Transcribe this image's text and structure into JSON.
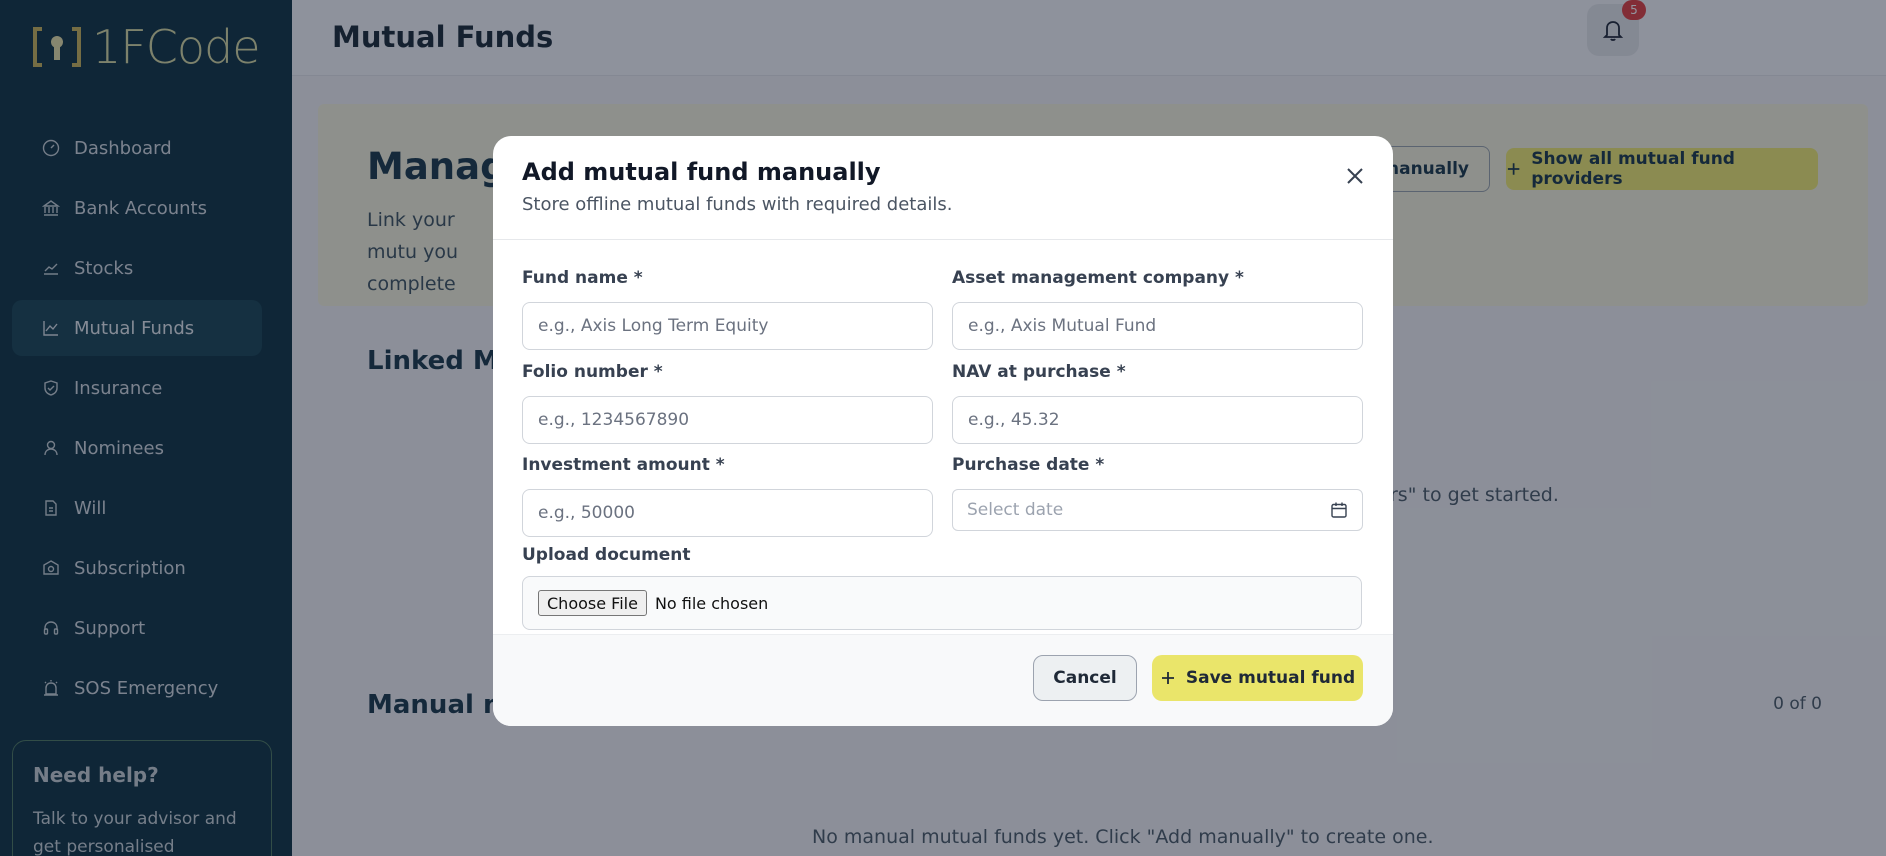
{
  "brand": {
    "name": "1FCode",
    "accent": "#d8dba2"
  },
  "sidebar": {
    "items": [
      {
        "label": "Dashboard",
        "icon": "gauge-icon"
      },
      {
        "label": "Bank Accounts",
        "icon": "bank-icon"
      },
      {
        "label": "Stocks",
        "icon": "trend-icon"
      },
      {
        "label": "Mutual Funds",
        "icon": "chart-line-icon",
        "active": true
      },
      {
        "label": "Insurance",
        "icon": "shield-icon"
      },
      {
        "label": "Nominees",
        "icon": "user-icon"
      },
      {
        "label": "Will",
        "icon": "document-icon"
      },
      {
        "label": "Subscription",
        "icon": "badge-icon"
      },
      {
        "label": "Support",
        "icon": "headset-icon"
      },
      {
        "label": "SOS Emergency",
        "icon": "alarm-icon"
      }
    ],
    "help": {
      "title": "Need help?",
      "text": "Talk to your advisor and get personalised"
    }
  },
  "header": {
    "title": "Mutual Funds",
    "notification_count": "5"
  },
  "main": {
    "hero_title": "Manage",
    "hero_desc": "Link your mutu you complete",
    "add_manually_label": "manually",
    "show_providers_label": "Show all mutual fund providers",
    "linked_title": "Linked Mut",
    "linked_empty": "rs\" to get started.",
    "manual_title": "Manual mu",
    "manual_count": "0 of 0",
    "manual_empty": "No manual mutual funds yet. Click \"Add manually\" to create one."
  },
  "modal": {
    "title": "Add mutual fund manually",
    "subtitle": "Store offline mutual funds with required details.",
    "fields": {
      "fund_name": {
        "label": "Fund name *",
        "placeholder": "e.g., Axis Long Term Equity"
      },
      "amc": {
        "label": "Asset management company *",
        "placeholder": "e.g., Axis Mutual Fund"
      },
      "folio": {
        "label": "Folio number *",
        "placeholder": "e.g., 1234567890"
      },
      "nav": {
        "label": "NAV at purchase *",
        "placeholder": "e.g., 45.32"
      },
      "amount": {
        "label": "Investment amount *",
        "placeholder": "e.g., 50000"
      },
      "date": {
        "label": "Purchase date *",
        "placeholder": "Select date"
      }
    },
    "upload": {
      "label": "Upload document",
      "button": "Choose File",
      "status": "No file chosen"
    },
    "cancel_label": "Cancel",
    "save_label": "Save mutual fund"
  },
  "colors": {
    "sidebar_bg": "#0f3442",
    "primary_yellow": "#eae56a",
    "badge_red": "#e04141"
  }
}
